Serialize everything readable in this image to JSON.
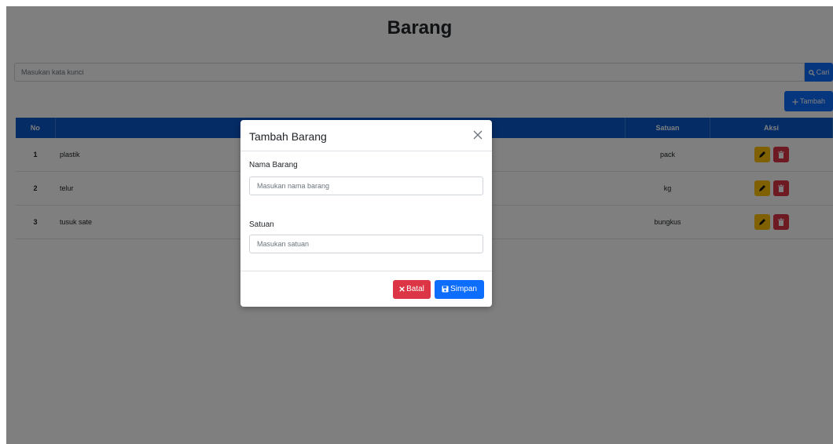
{
  "page": {
    "title": "Barang"
  },
  "search": {
    "placeholder": "Masukan kata kunci",
    "button_label": "Cari"
  },
  "toolbar": {
    "add_label": "Tambah"
  },
  "table": {
    "headers": [
      "No",
      "",
      "Satuan",
      "Aksi"
    ],
    "rows": [
      {
        "no": "1",
        "name": "plastik",
        "unit": "pack"
      },
      {
        "no": "2",
        "name": "telur",
        "unit": "kg"
      },
      {
        "no": "3",
        "name": "tusuk sate",
        "unit": "bungkus"
      }
    ]
  },
  "modal": {
    "title": "Tambah Barang",
    "name_label": "Nama Barang",
    "name_placeholder": "Masukan nama barang",
    "unit_label": "Satuan",
    "unit_placeholder": "Masukan satuan",
    "cancel_label": "Batal",
    "save_label": "Simpan"
  },
  "icons": {
    "search": "search-icon",
    "add": "plus-icon",
    "edit": "pencil-icon",
    "delete": "trash-icon",
    "close": "close-icon",
    "cancel": "x-icon",
    "save": "floppy-icon"
  },
  "colors": {
    "primary": "#0d6efd",
    "header": "#0a58ca",
    "danger": "#dc3545",
    "warning": "#ffc107"
  }
}
